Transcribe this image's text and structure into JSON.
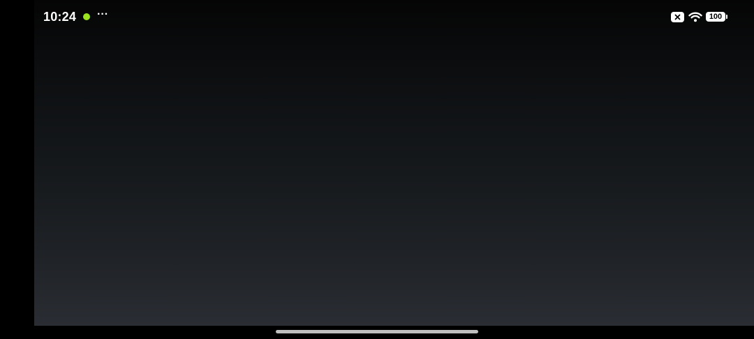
{
  "status_bar": {
    "time": "10:24",
    "overflow": "···",
    "recording_dot_color": "#9be21f",
    "sim_icon": "sim-disabled-icon",
    "wifi_icon": "wifi-icon",
    "battery_level": "100"
  },
  "colors": {
    "background_top": "#050505",
    "background_bottom": "#2a2d33",
    "home_indicator": "#bfbfbf"
  }
}
